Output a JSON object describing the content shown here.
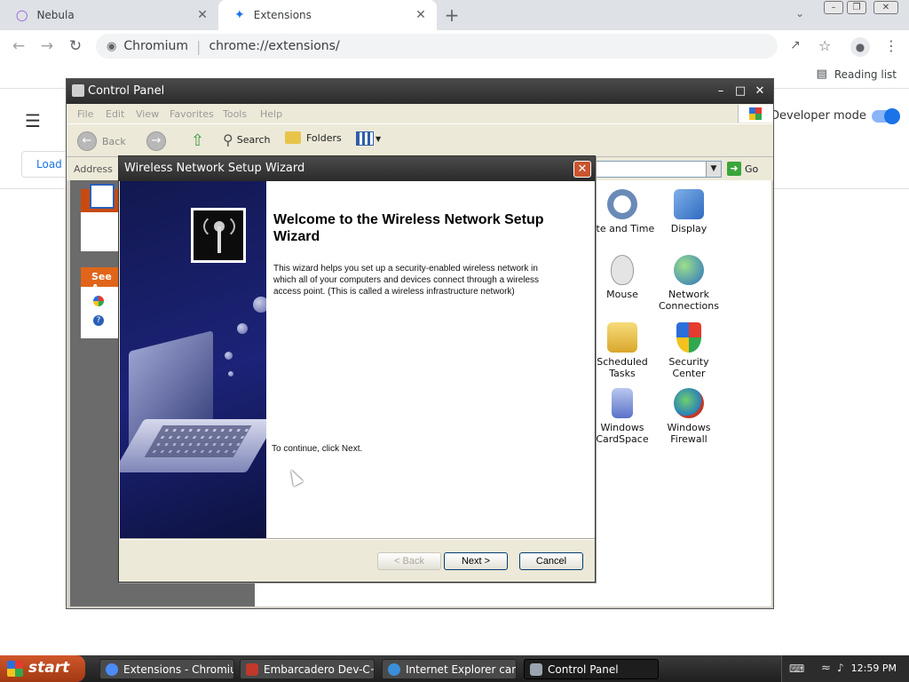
{
  "browser": {
    "tabs": [
      {
        "title": "Nebula",
        "icon": "nebula-icon"
      },
      {
        "title": "Extensions",
        "icon": "puzzle-icon"
      }
    ],
    "omnibox": {
      "site": "Chromium",
      "url": "chrome://extensions/"
    },
    "reading_list": "Reading list"
  },
  "extensions_page": {
    "load_button": "Load",
    "developer_mode": "Developer mode",
    "developer_mode_on": true,
    "accent": "#1a73e8"
  },
  "control_panel": {
    "title": "Control Panel",
    "menu": [
      "File",
      "Edit",
      "View",
      "Favorites",
      "Tools",
      "Help"
    ],
    "toolbar": {
      "back": "Back",
      "search": "Search",
      "folders": "Folders"
    },
    "address_label": "Address",
    "go": "Go",
    "see_also": "See A",
    "icons": [
      {
        "label": "ate and Time",
        "icon": "clock-icon"
      },
      {
        "label": "Display",
        "icon": "monitor-icon"
      },
      {
        "label": "Mouse",
        "icon": "mouse-icon"
      },
      {
        "label": "Network Connections",
        "icon": "globe-icon"
      },
      {
        "label": "Scheduled Tasks",
        "icon": "folder-clock-icon"
      },
      {
        "label": "Security Center",
        "icon": "shield-icon"
      },
      {
        "label": "Windows CardSpace",
        "icon": "cardspace-icon"
      },
      {
        "label": "Windows Firewall",
        "icon": "firewall-icon"
      }
    ]
  },
  "wizard": {
    "title": "Wireless Network Setup Wizard",
    "heading": "Welcome to the Wireless Network Setup Wizard",
    "body": "This wizard helps you set up a security-enabled wireless network in which all of your computers and devices connect through a wireless access point. (This is called a wireless infrastructure network)",
    "continue_text": "To continue, click Next.",
    "buttons": {
      "back": "< Back",
      "next": "Next >",
      "cancel": "Cancel"
    }
  },
  "taskbar": {
    "start": "start",
    "tasks": [
      {
        "label": "Extensions - Chromium",
        "color": "#4c8bf5"
      },
      {
        "label": "Embarcadero Dev-C++",
        "color": "#c0392b"
      },
      {
        "label": "Internet Explorer can...",
        "color": "#3a8fd8"
      },
      {
        "label": "Control Panel",
        "color": "#9aa4b0"
      }
    ],
    "clock": "12:59 PM"
  }
}
